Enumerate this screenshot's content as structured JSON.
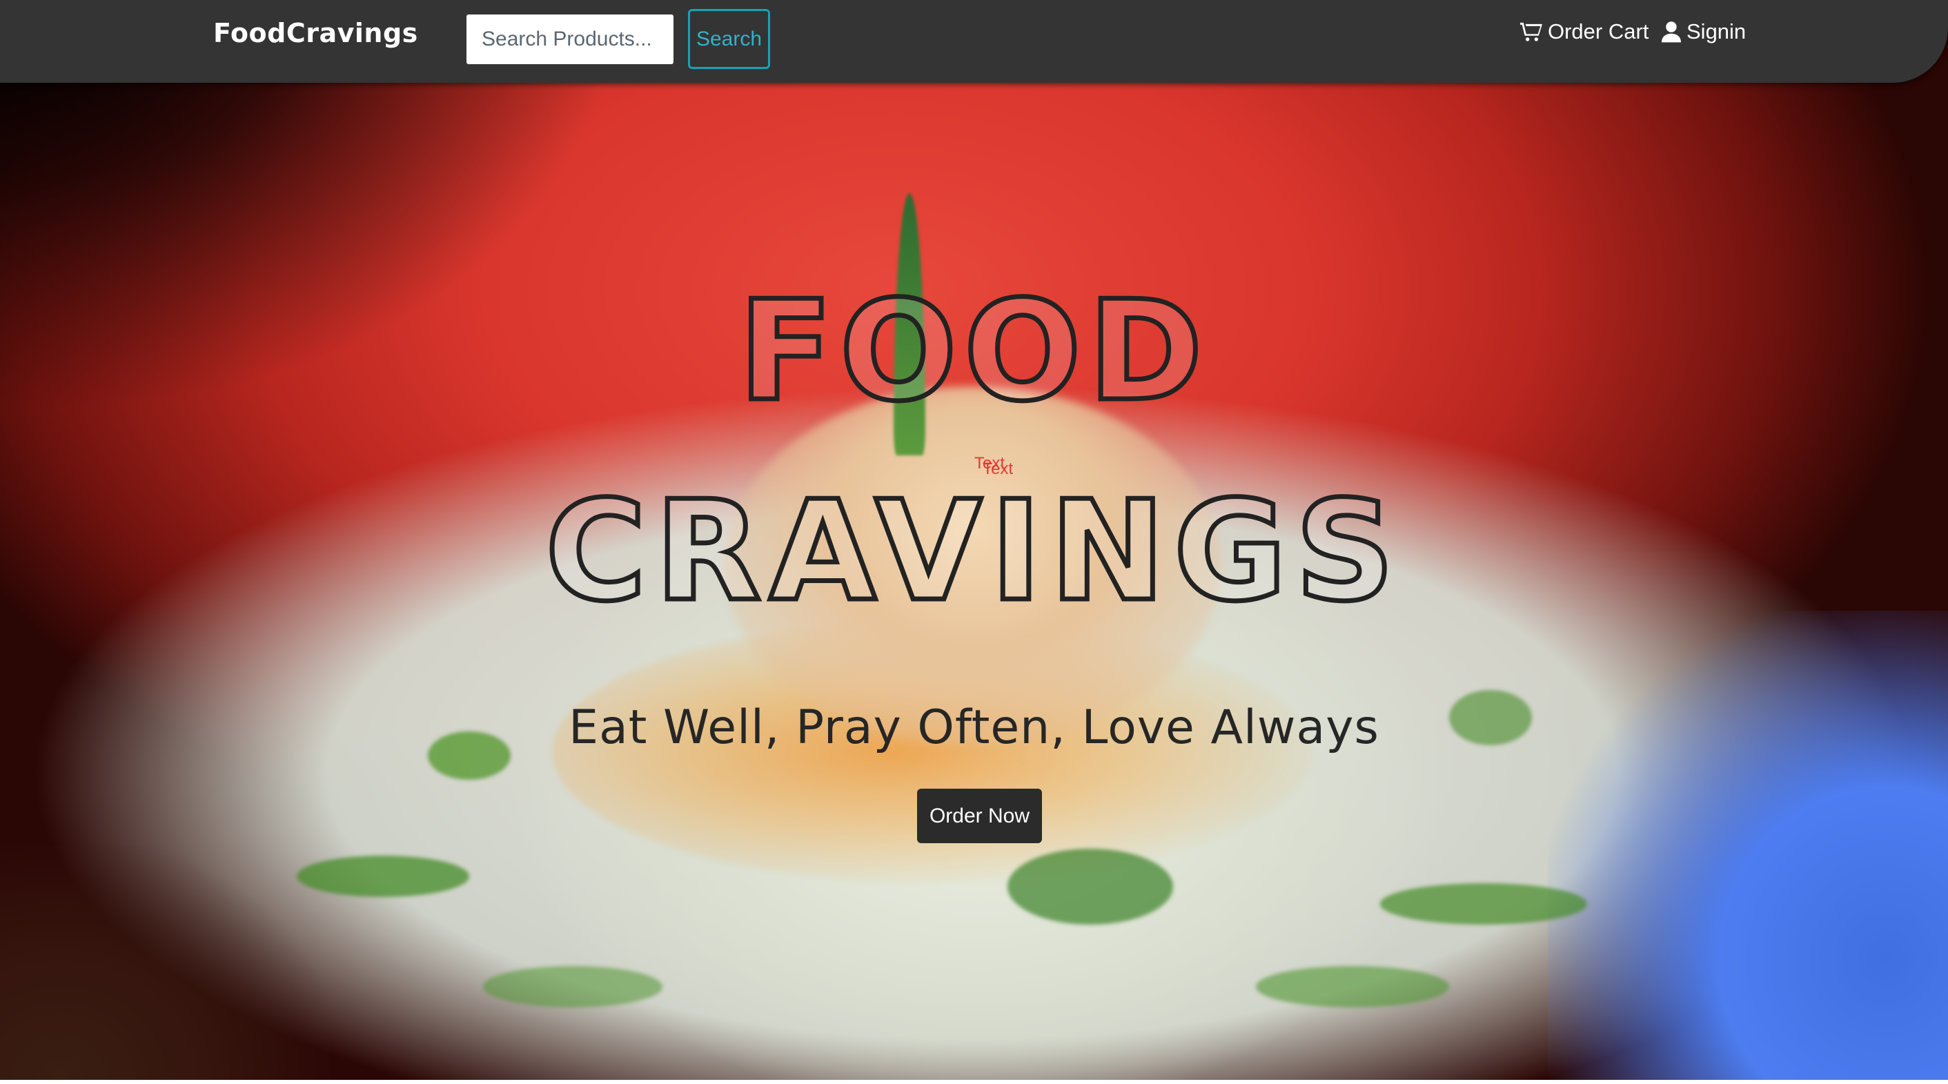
{
  "navbar": {
    "brand": "FoodCravings",
    "search_placeholder": "Search Products...",
    "search_button": "Search",
    "cart_label": "Order Cart",
    "cart_icon": "shopping-cart-icon",
    "signin_label": "Signin",
    "signin_icon": "user-icon"
  },
  "hero": {
    "title_line1": "FOOD",
    "title_line2": "CRAVINGS",
    "debug_text_1": "Text",
    "debug_text_2": "Text",
    "tagline": "Eat Well, Pray Often, Love Always",
    "cta_button": "Order Now"
  },
  "colors": {
    "navbar_bg": "#343434",
    "search_button_accent": "#17a2b8",
    "cta_bg": "#2b2b2b",
    "debug_text": "#e53935"
  }
}
